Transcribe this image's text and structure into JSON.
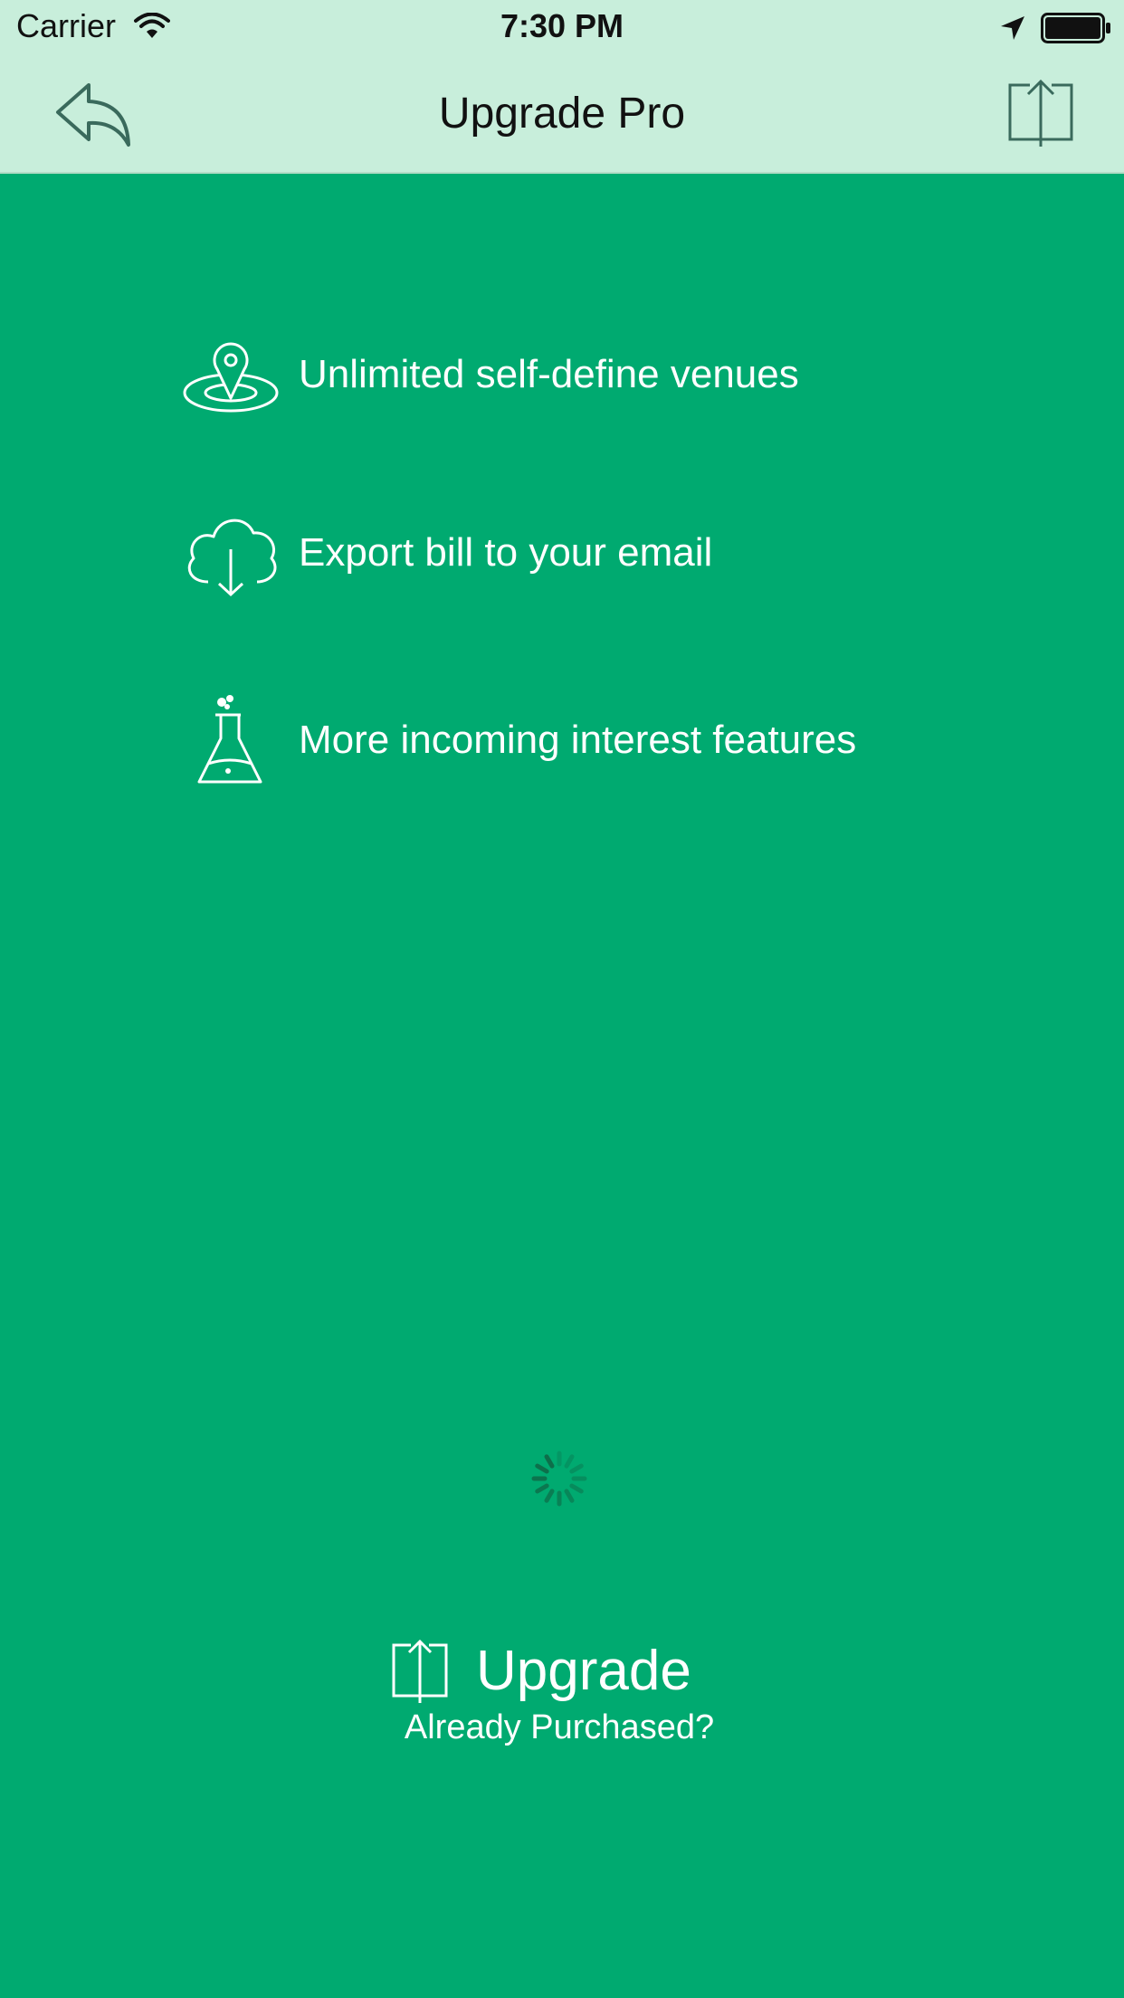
{
  "status_bar": {
    "carrier": "Carrier",
    "time": "7:30 PM",
    "icons": [
      "wifi-icon",
      "location-arrow-icon",
      "battery-icon"
    ]
  },
  "nav": {
    "title": "Upgrade Pro",
    "back_icon": "reply-arrow-icon",
    "share_icon": "share-icon"
  },
  "features": [
    {
      "icon": "map-pin-icon",
      "label": "Unlimited self-define venues"
    },
    {
      "icon": "cloud-download-icon",
      "label": "Export bill to your email"
    },
    {
      "icon": "flask-icon",
      "label": "More incoming interest features"
    }
  ],
  "loading": {
    "icon": "activity-spinner-icon"
  },
  "actions": {
    "upgrade_label": "Upgrade",
    "upgrade_icon": "upload-icon",
    "purchased_label": "Already Purchased?"
  },
  "colors": {
    "background": "#00aa70",
    "nav_background": "#c8eedb",
    "foreground": "#ffffff"
  }
}
